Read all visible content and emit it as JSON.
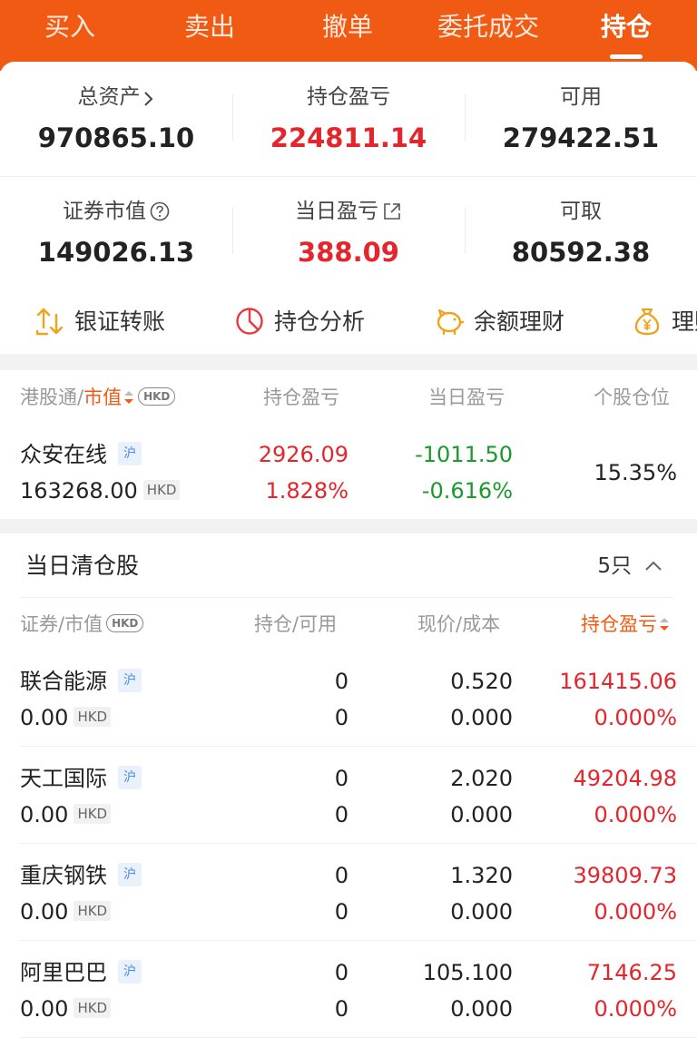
{
  "tabs": [
    {
      "label": "买入"
    },
    {
      "label": "卖出"
    },
    {
      "label": "撤单"
    },
    {
      "label": "委托成交"
    },
    {
      "label": "持仓"
    }
  ],
  "summary": {
    "total_assets": {
      "label": "总资产",
      "value": "970865.10"
    },
    "position_pl": {
      "label": "持仓盈亏",
      "value": "224811.14"
    },
    "available": {
      "label": "可用",
      "value": "279422.51"
    },
    "securities_value": {
      "label": "证券市值",
      "value": "149026.13"
    },
    "daily_pl": {
      "label": "当日盈亏",
      "value": "388.09"
    },
    "withdrawable": {
      "label": "可取",
      "value": "80592.38"
    }
  },
  "quick_links": [
    {
      "label": "银证转账",
      "icon": "transfer-icon"
    },
    {
      "label": "持仓分析",
      "icon": "pie-chart-icon"
    },
    {
      "label": "余额理财",
      "icon": "piggy-bank-icon"
    },
    {
      "label": "理财",
      "icon": "money-bag-icon"
    }
  ],
  "hk_section": {
    "headers": {
      "name": "港股通",
      "sep": "/",
      "sort": "市值",
      "currency": "HKD",
      "position_pl": "持仓盈亏",
      "daily_pl": "当日盈亏",
      "weight": "个股仓位"
    },
    "rows": [
      {
        "name": "众安在线",
        "market": "沪",
        "market_value": "163268.00",
        "currency": "HKD",
        "position_pl": "2926.09",
        "position_pl_pct": "1.828%",
        "daily_pl": "-1011.50",
        "daily_pl_pct": "-0.616%",
        "weight": "15.35%"
      }
    ]
  },
  "cleared": {
    "title": "当日清仓股",
    "count": "5只",
    "headers": {
      "security": "证券",
      "sep": "/",
      "market_value": "市值",
      "currency": "HKD",
      "holding": "持仓/可用",
      "price": "现价/成本",
      "pl": "持仓盈亏"
    },
    "rows": [
      {
        "name": "联合能源",
        "market": "沪",
        "value": "0.00",
        "currency": "HKD",
        "holding": "0",
        "available": "0",
        "price": "0.520",
        "cost": "0.000",
        "pl": "161415.06",
        "pl_pct": "0.000%"
      },
      {
        "name": "天工国际",
        "market": "沪",
        "value": "0.00",
        "currency": "HKD",
        "holding": "0",
        "available": "0",
        "price": "2.020",
        "cost": "0.000",
        "pl": "49204.98",
        "pl_pct": "0.000%"
      },
      {
        "name": "重庆钢铁",
        "market": "沪",
        "value": "0.00",
        "currency": "HKD",
        "holding": "0",
        "available": "0",
        "price": "1.320",
        "cost": "0.000",
        "pl": "39809.73",
        "pl_pct": "0.000%"
      },
      {
        "name": "阿里巴巴",
        "market": "沪",
        "value": "0.00",
        "currency": "HKD",
        "holding": "0",
        "available": "0",
        "price": "105.100",
        "cost": "0.000",
        "pl": "7146.25",
        "pl_pct": "0.000%"
      }
    ]
  },
  "colors": {
    "brand": "#f05a12",
    "profit": "#e4262c",
    "loss": "#1a9a2c"
  }
}
